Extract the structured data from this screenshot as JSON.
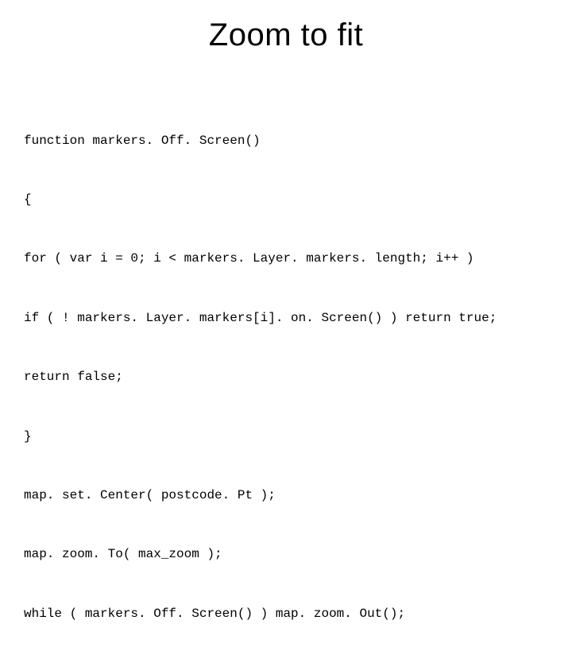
{
  "title": "Zoom to fit",
  "code": {
    "l1": "function markers. Off. Screen()",
    "l2": "{",
    "l3": "for ( var i = 0; i < markers. Layer. markers. length; i++ )",
    "l4": "if ( ! markers. Layer. markers[i]. on. Screen() ) return true;",
    "l5": "return false;",
    "l6": "}",
    "l7": "map. set. Center( postcode. Pt );",
    "l8": "map. zoom. To( max_zoom );",
    "l9": "while ( markers. Off. Screen() ) map. zoom. Out();"
  }
}
